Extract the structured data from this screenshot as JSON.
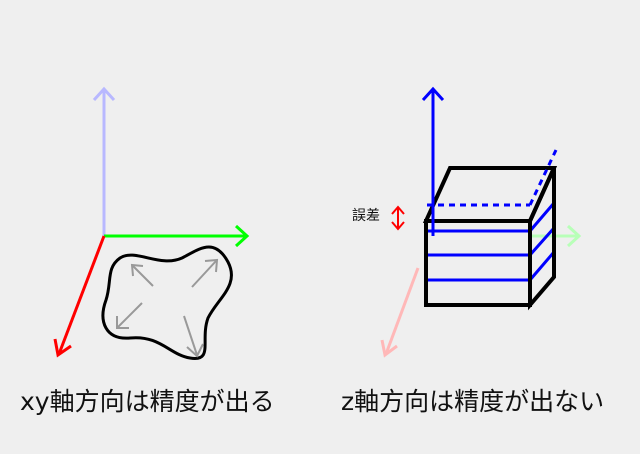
{
  "left_panel": {
    "caption": "xy軸方向は精度が出る"
  },
  "right_panel": {
    "caption": "z軸方向は精度が出ない",
    "error_label": "誤差"
  },
  "colors": {
    "background": "#efefef",
    "x_axis": "#ff0000",
    "y_axis": "#00ff00",
    "z_axis_faded": "#b8b8ff",
    "z_axis": "#0000ff",
    "layer_lines": "#0000ff",
    "faded_red": "#ffb8b8",
    "faded_green": "#b8ffb8",
    "error_arrow": "#ff0000",
    "outline": "#000000",
    "shrink_arrows": "#999999"
  }
}
